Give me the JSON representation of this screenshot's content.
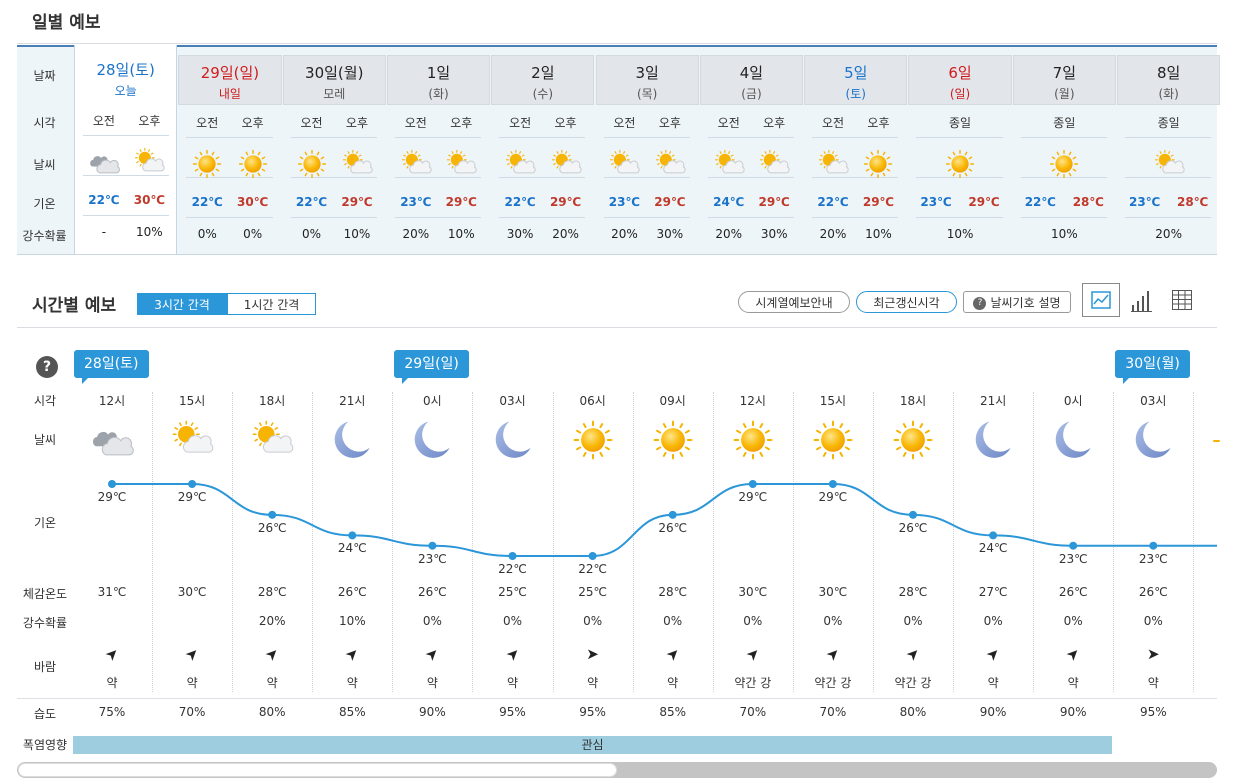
{
  "daily": {
    "title": "일별 예보",
    "row_labels": [
      "날짜",
      "시각",
      "날씨",
      "기온",
      "강수확률"
    ],
    "days": [
      {
        "name": "28일(토)",
        "sub": "오늘",
        "color": "blue",
        "today": true,
        "periods": [
          {
            "label": "오전",
            "icon": "cloudy-icon",
            "low": "22℃",
            "prob": "-"
          },
          {
            "label": "오후",
            "icon": "partly-cloudy-icon",
            "high": "30℃",
            "prob": "10%"
          }
        ]
      },
      {
        "name": "29일(일)",
        "sub": "내일",
        "color": "red",
        "periods": [
          {
            "label": "오전",
            "icon": "sun-icon",
            "low": "22℃",
            "prob": "0%"
          },
          {
            "label": "오후",
            "icon": "sun-icon",
            "high": "30℃",
            "prob": "0%"
          }
        ]
      },
      {
        "name": "30일(월)",
        "sub": "모레",
        "color": "",
        "periods": [
          {
            "label": "오전",
            "icon": "sun-icon",
            "low": "22℃",
            "prob": "0%"
          },
          {
            "label": "오후",
            "icon": "partly-cloudy-icon",
            "high": "29℃",
            "prob": "10%"
          }
        ]
      },
      {
        "name": "1일",
        "sub": "(화)",
        "color": "",
        "periods": [
          {
            "label": "오전",
            "icon": "partly-cloudy-icon",
            "low": "23℃",
            "prob": "20%"
          },
          {
            "label": "오후",
            "icon": "partly-cloudy-icon",
            "high": "29℃",
            "prob": "10%"
          }
        ]
      },
      {
        "name": "2일",
        "sub": "(수)",
        "color": "",
        "periods": [
          {
            "label": "오전",
            "icon": "partly-cloudy-icon",
            "low": "22℃",
            "prob": "30%"
          },
          {
            "label": "오후",
            "icon": "partly-cloudy-icon",
            "high": "29℃",
            "prob": "20%"
          }
        ]
      },
      {
        "name": "3일",
        "sub": "(목)",
        "color": "",
        "periods": [
          {
            "label": "오전",
            "icon": "partly-cloudy-icon",
            "low": "23℃",
            "prob": "20%"
          },
          {
            "label": "오후",
            "icon": "partly-cloudy-icon",
            "high": "29℃",
            "prob": "30%"
          }
        ]
      },
      {
        "name": "4일",
        "sub": "(금)",
        "color": "",
        "periods": [
          {
            "label": "오전",
            "icon": "partly-cloudy-icon",
            "low": "24℃",
            "prob": "20%"
          },
          {
            "label": "오후",
            "icon": "partly-cloudy-icon",
            "high": "29℃",
            "prob": "30%"
          }
        ]
      },
      {
        "name": "5일",
        "sub": "(토)",
        "color": "blue",
        "periods": [
          {
            "label": "오전",
            "icon": "partly-cloudy-icon",
            "low": "22℃",
            "prob": "20%"
          },
          {
            "label": "오후",
            "icon": "sun-icon",
            "high": "29℃",
            "prob": "10%"
          }
        ]
      },
      {
        "name": "6일",
        "sub": "(일)",
        "color": "red",
        "periods": [
          {
            "label": "종일",
            "icon": "sun-icon",
            "low": "23℃",
            "high": "29℃",
            "prob": "10%"
          }
        ]
      },
      {
        "name": "7일",
        "sub": "(월)",
        "color": "",
        "periods": [
          {
            "label": "종일",
            "icon": "sun-icon",
            "low": "22℃",
            "high": "28℃",
            "prob": "10%"
          }
        ]
      },
      {
        "name": "8일",
        "sub": "(화)",
        "color": "",
        "periods": [
          {
            "label": "종일",
            "icon": "partly-cloudy-icon",
            "low": "23℃",
            "high": "28℃",
            "prob": "20%"
          }
        ]
      }
    ]
  },
  "hourly": {
    "title": "시간별 예보",
    "tabs": [
      {
        "label": "3시간 간격",
        "active": true
      },
      {
        "label": "1시간 간격",
        "active": false
      }
    ],
    "buttons": {
      "timeseries": "시계열예보안내",
      "recent": "최근갱신시각",
      "symbols": "날씨기호 설명"
    },
    "help": "?",
    "row_labels": {
      "time": "시각",
      "weather": "날씨",
      "temp": "기온",
      "feels": "체감온도",
      "prob": "강수확률",
      "wind": "바람",
      "humidity": "습도",
      "heat": "폭염영향"
    },
    "day_badges": [
      {
        "label": "28일(토)",
        "col": 0
      },
      {
        "label": "29일(일)",
        "col": 4
      },
      {
        "label": "30일(월)",
        "col": 13
      }
    ],
    "heat_label": "관심",
    "columns": [
      {
        "time": "12시",
        "icon": "cloudy-icon",
        "temp": 29,
        "temp_label": "29℃",
        "feels": "31℃",
        "prob": "",
        "wind_dir": "ne",
        "wind": "약",
        "hum": "75%"
      },
      {
        "time": "15시",
        "icon": "partly-cloudy-icon",
        "temp": 29,
        "temp_label": "29℃",
        "feels": "30℃",
        "prob": "",
        "wind_dir": "ne",
        "wind": "약",
        "hum": "70%"
      },
      {
        "time": "18시",
        "icon": "partly-cloudy-icon",
        "temp": 26,
        "temp_label": "26℃",
        "feels": "28℃",
        "prob": "20%",
        "wind_dir": "ne",
        "wind": "약",
        "hum": "80%"
      },
      {
        "time": "21시",
        "icon": "moon-icon",
        "temp": 24,
        "temp_label": "24℃",
        "feels": "26℃",
        "prob": "10%",
        "wind_dir": "ne",
        "wind": "약",
        "hum": "85%"
      },
      {
        "time": "0시",
        "icon": "moon-icon",
        "temp": 23,
        "temp_label": "23℃",
        "feels": "26℃",
        "prob": "0%",
        "wind_dir": "ne",
        "wind": "약",
        "hum": "90%"
      },
      {
        "time": "03시",
        "icon": "moon-icon",
        "temp": 22,
        "temp_label": "22℃",
        "feels": "25℃",
        "prob": "0%",
        "wind_dir": "ne",
        "wind": "약",
        "hum": "95%"
      },
      {
        "time": "06시",
        "icon": "sun-icon",
        "temp": 22,
        "temp_label": "22℃",
        "feels": "25℃",
        "prob": "0%",
        "wind_dir": "e",
        "wind": "약",
        "hum": "95%"
      },
      {
        "time": "09시",
        "icon": "sun-icon",
        "temp": 26,
        "temp_label": "26℃",
        "feels": "28℃",
        "prob": "0%",
        "wind_dir": "ne",
        "wind": "약",
        "hum": "85%"
      },
      {
        "time": "12시",
        "icon": "sun-icon",
        "temp": 29,
        "temp_label": "29℃",
        "feels": "30℃",
        "prob": "0%",
        "wind_dir": "ne",
        "wind": "약간 강",
        "hum": "70%"
      },
      {
        "time": "15시",
        "icon": "sun-icon",
        "temp": 29,
        "temp_label": "29℃",
        "feels": "30℃",
        "prob": "0%",
        "wind_dir": "ne",
        "wind": "약간 강",
        "hum": "70%"
      },
      {
        "time": "18시",
        "icon": "sun-icon",
        "temp": 26,
        "temp_label": "26℃",
        "feels": "28℃",
        "prob": "0%",
        "wind_dir": "ne",
        "wind": "약간 강",
        "hum": "80%"
      },
      {
        "time": "21시",
        "icon": "moon-icon",
        "temp": 24,
        "temp_label": "24℃",
        "feels": "27℃",
        "prob": "0%",
        "wind_dir": "ne",
        "wind": "약",
        "hum": "90%"
      },
      {
        "time": "0시",
        "icon": "moon-icon",
        "temp": 23,
        "temp_label": "23℃",
        "feels": "26℃",
        "prob": "0%",
        "wind_dir": "ne",
        "wind": "약",
        "hum": "90%"
      },
      {
        "time": "03시",
        "icon": "moon-icon",
        "temp": 23,
        "temp_label": "23℃",
        "feels": "26℃",
        "prob": "0%",
        "wind_dir": "e",
        "wind": "약",
        "hum": "95%"
      }
    ],
    "scroll_fraction": 0.5
  }
}
